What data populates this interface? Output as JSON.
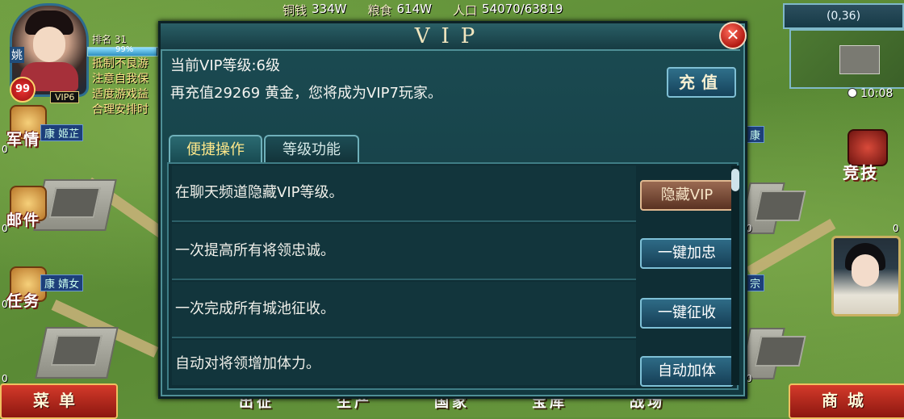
{
  "resources": {
    "copper_label": "铜钱",
    "copper_value": "334W",
    "grain_label": "粮食",
    "grain_value": "614W",
    "pop_label": "人口",
    "pop_value": "54070/63819"
  },
  "map": {
    "coords": "(0,36)",
    "time": "10:08"
  },
  "player": {
    "name_tag": "姚",
    "level": "99",
    "vip_tag": "VIP6",
    "rank": "排名 31",
    "progress_pct": "99%",
    "progress": 0.99,
    "notice": [
      "抵制不良游",
      "注意自我保",
      "适度游戏益",
      "合理安排时"
    ]
  },
  "left_buttons": [
    {
      "label": "军情"
    },
    {
      "label": "邮件"
    },
    {
      "label": "任务"
    }
  ],
  "city_labels": [
    {
      "text": "康 姬芷"
    },
    {
      "text": "康 婧女"
    }
  ],
  "right_labels": [
    "康",
    "宗"
  ],
  "small_zero": "0",
  "right": {
    "jingji_label": "竞技"
  },
  "bottom": {
    "menu_label": "菜单",
    "shop_label": "商城",
    "nav": [
      "出征",
      "生产",
      "国家",
      "宝库",
      "战场"
    ]
  },
  "dialog": {
    "title": "VIP",
    "close_symbol": "✕",
    "current_level": "当前VIP等级:6级",
    "next_level": "再充值29269 黄金，您将成为VIP7玩家。",
    "recharge_label": "充值",
    "tabs": [
      "便捷操作",
      "等级功能"
    ],
    "rows": [
      {
        "text": "在聊天频道隐藏VIP等级。",
        "button": "隐藏VIP"
      },
      {
        "text": "一次提高所有将领忠诚。",
        "button": "一键加忠"
      },
      {
        "text": "一次完成所有城池征收。",
        "button": "一键征收"
      },
      {
        "text": "自动对将领增加体力。",
        "button": "自动加体"
      }
    ]
  }
}
